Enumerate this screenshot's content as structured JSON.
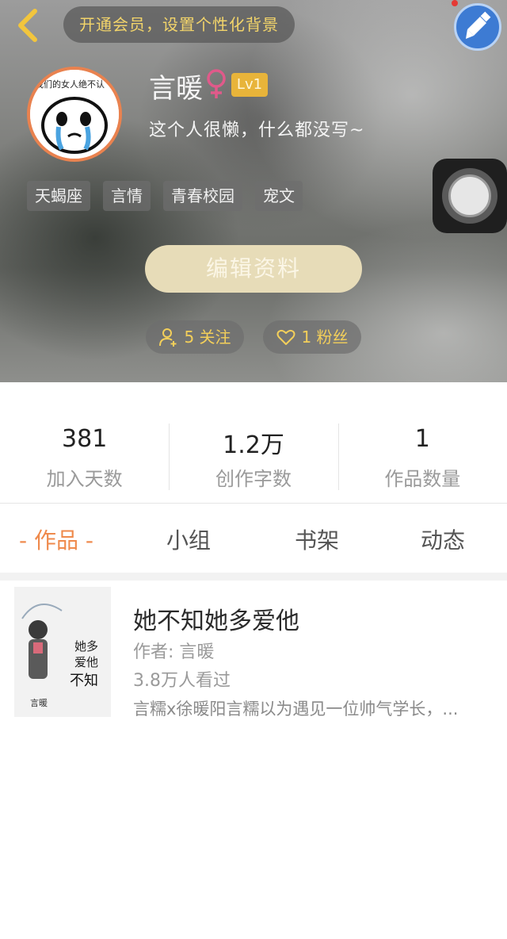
{
  "header": {
    "promo_text": "开通会员，设置个性化背景",
    "avatar_text": "我们的女人绝不认",
    "username": "言暖",
    "level": "Lv1",
    "bio": "这个人很懒，什么都没写~",
    "tags": [
      "天蝎座",
      "言情",
      "青春校园",
      "宠文"
    ],
    "edit_label": "编辑资料",
    "following_label": "5 关注",
    "fans_label": "1 粉丝",
    "colors": {
      "accent": "#ef8a4c",
      "gold": "#f3cf5a",
      "female": "#e05a8a"
    }
  },
  "stats": [
    {
      "value": "381",
      "label": "加入天数"
    },
    {
      "value": "1.2万",
      "label": "创作字数"
    },
    {
      "value": "1",
      "label": "作品数量"
    }
  ],
  "tabs": [
    {
      "label": "作品",
      "active": true
    },
    {
      "label": "小组",
      "active": false
    },
    {
      "label": "书架",
      "active": false
    },
    {
      "label": "动态",
      "active": false
    }
  ],
  "active_tab_decor": "- 作品 -",
  "book": {
    "title": "她不知她多爱他",
    "author": "作者: 言暖",
    "views": "3.8万人看过",
    "description": "言糯x徐暖阳言糯以为遇见一位帅气学长，...",
    "cover_title": "她不知她多爱他",
    "cover_author": "言暖"
  },
  "icons": {
    "back": "chevron-left-icon",
    "skin": "paint-brush-icon",
    "female": "female-symbol-icon",
    "follow": "user-plus-icon",
    "fans": "heart-icon"
  }
}
